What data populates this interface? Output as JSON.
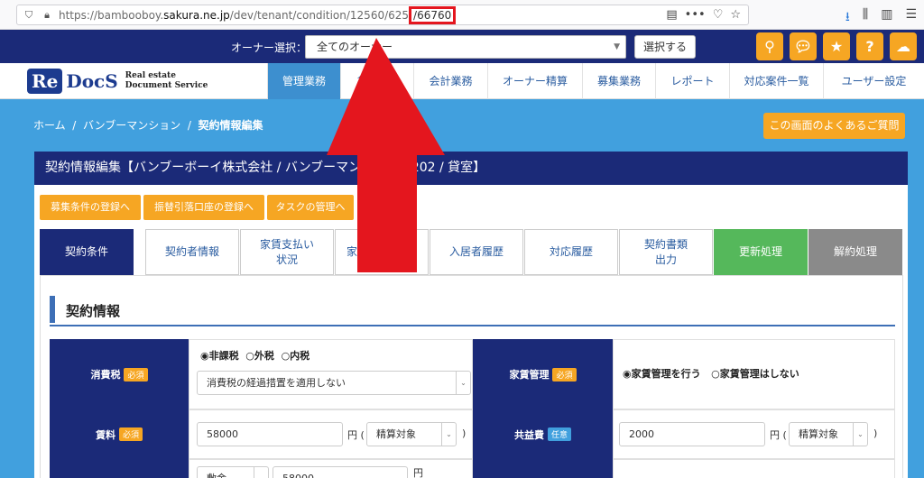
{
  "browser": {
    "url_base": "https://bambooboy.",
    "url_domain": "sakura.ne.jp",
    "url_path": "/dev/tenant/condition/12560/625",
    "url_highlight": "/66760",
    "page_actions": "•••",
    "colors": {
      "highlight": "#e4161e"
    }
  },
  "owner_bar": {
    "label": "オーナー選択：",
    "selected": "全てのオーナー",
    "select_button": "選択する"
  },
  "logo": {
    "re": "Re",
    "docs": "DocS",
    "sub1": "Real estate",
    "sub2": "Document Service"
  },
  "nav": {
    "items": [
      "管理業務",
      "賃貸",
      "会計業務",
      "オーナー精算",
      "募集業務",
      "レポート",
      "対応案件一覧",
      "ユーザー設定"
    ]
  },
  "breadcrumb": {
    "home": "ホーム",
    "sep": "/",
    "property": "バンブーマンション",
    "current": "契約情報編集"
  },
  "faq_button": "この画面のよくあるご質問",
  "panel": {
    "header": "契約情報編集【バンブーボーイ株式会社 / バンブーマンション / 202 / 貸室】",
    "actions": [
      "募集条件の登録へ",
      "振替引落口座の登録へ",
      "タスクの管理へ"
    ],
    "tabs": [
      {
        "label": "契約条件"
      },
      {
        "label": "契約者情報"
      },
      {
        "label": "家賃支払い\n状況"
      },
      {
        "label": "家賃"
      },
      {
        "label": "入居者履歴"
      },
      {
        "label": "対応履歴"
      },
      {
        "label": "契約書類\n出力"
      },
      {
        "label": "更新処理"
      },
      {
        "label": "解約処理"
      }
    ],
    "section_title": "契約情報",
    "rows": {
      "tax_label": "消費税",
      "required": "必須",
      "optional": "任意",
      "tax_options": [
        "◉非課税",
        "○外税",
        "○内税"
      ],
      "tax_select": "消費税の経過措置を適用しない",
      "mgmt_label": "家賃管理",
      "mgmt_options": [
        "◉家賃管理を行う",
        "○家賃管理はしない"
      ],
      "rent_label": "賃料",
      "rent_value": "58000",
      "unit": "円 (",
      "close": ")",
      "settle_select": "精算対象",
      "common_label": "共益費",
      "common_value": "2000",
      "bottom_select": "敷金",
      "bottom_value": "58000",
      "bottom_unit": "円"
    }
  }
}
